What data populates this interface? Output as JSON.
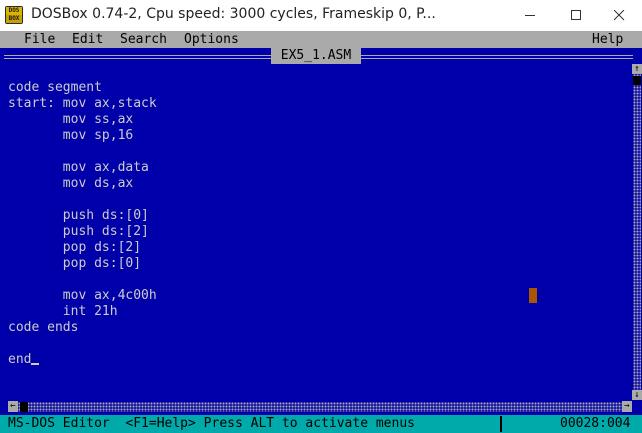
{
  "window": {
    "title": "DOSBox 0.74-2, Cpu speed:     3000 cycles, Frameskip  0, P...",
    "icon_top": "DOS",
    "icon_bottom": "BOX"
  },
  "menu": {
    "file": "File",
    "edit": "Edit",
    "search": "Search",
    "options": "Options",
    "help": "Help"
  },
  "editor": {
    "document_title": "EX5_1.ASM",
    "lines": [
      "",
      "code segment",
      "start: mov ax,stack",
      "       mov ss,ax",
      "       mov sp,16",
      "",
      "       mov ax,data",
      "       mov ds,ax",
      "",
      "       push ds:[0]",
      "       push ds:[2]",
      "       pop ds:[2]",
      "       pop ds:[0]",
      "",
      "       mov ax,4c00h",
      "       int 21h",
      "code ends",
      "",
      "end"
    ]
  },
  "scrollbar": {
    "up_arrow": "↑",
    "down_arrow": "↓",
    "left_arrow": "←",
    "right_arrow": "→"
  },
  "status": {
    "message": "MS-DOS Editor  <F1=Help> Press ALT to activate menus",
    "position": "00028:004"
  },
  "colors": {
    "editor_bg": "#0000aa",
    "text": "#cccccc",
    "menu_bg": "#aaaaaa",
    "status_bg": "#00aaaa",
    "mouse_cursor": "#aa5500"
  }
}
